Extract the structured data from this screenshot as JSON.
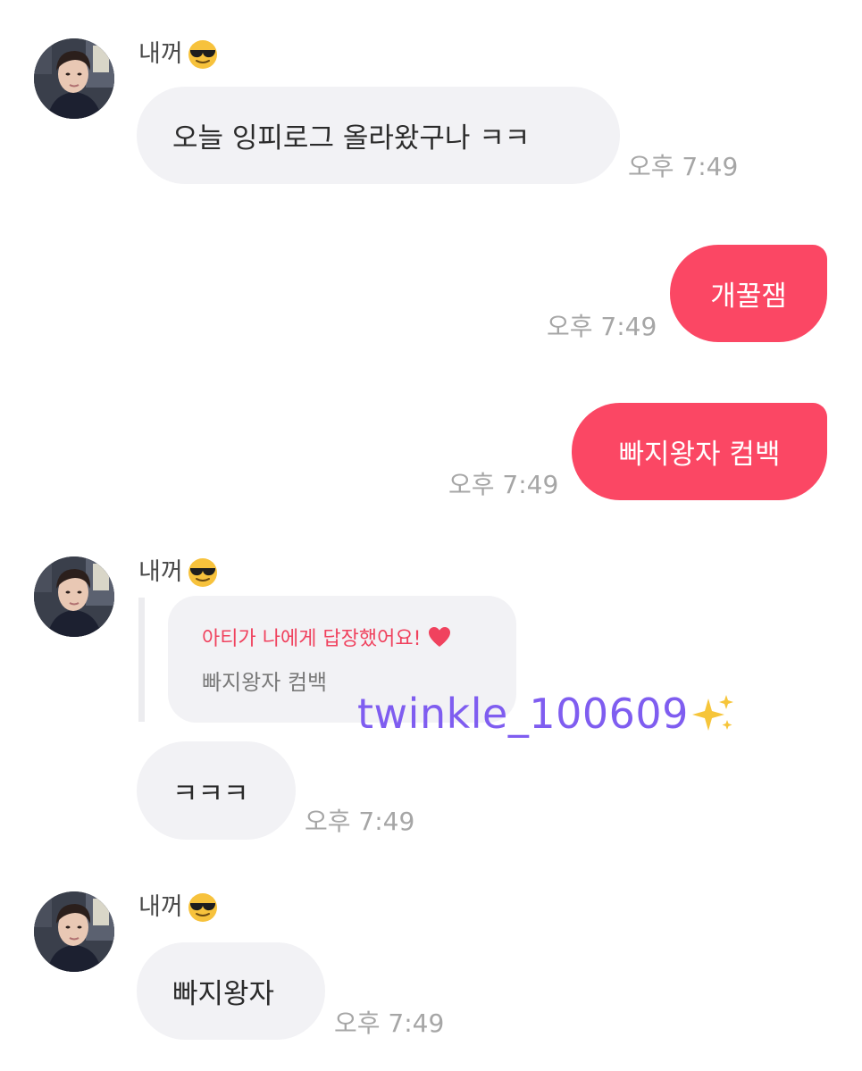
{
  "messages": [
    {
      "type": "incoming",
      "sender": "내꺼",
      "sender_emoji": "smiling-face-with-sunglasses-emoji",
      "text": "오늘 잉피로그 올라왔구나 ㅋㅋ",
      "time": "오후 7:49"
    },
    {
      "type": "outgoing",
      "text": "개꿀잼",
      "time": "오후 7:49"
    },
    {
      "type": "outgoing",
      "text": "빠지왕자 컴백",
      "time": "오후 7:49"
    },
    {
      "type": "incoming-reply",
      "sender": "내꺼",
      "sender_emoji": "smiling-face-with-sunglasses-emoji",
      "reply_header": "아티가 나에게 답장했어요!",
      "reply_header_icon": "heart-icon",
      "reply_quote": "빠지왕자 컴백",
      "text": "ㅋㅋㅋ",
      "time": "오후 7:49"
    },
    {
      "type": "incoming",
      "sender": "내꺼",
      "sender_emoji": "smiling-face-with-sunglasses-emoji",
      "text": "빠지왕자",
      "time": "오후 7:49"
    }
  ],
  "watermark": {
    "text": "twinkle_100609",
    "icon": "sparkles-icon"
  },
  "colors": {
    "outgoing_bubble": "#fb4764",
    "incoming_bubble": "#f2f2f5",
    "time_text": "#a6a6a6",
    "reply_header": "#f0425e",
    "watermark": "#7f5df0"
  }
}
